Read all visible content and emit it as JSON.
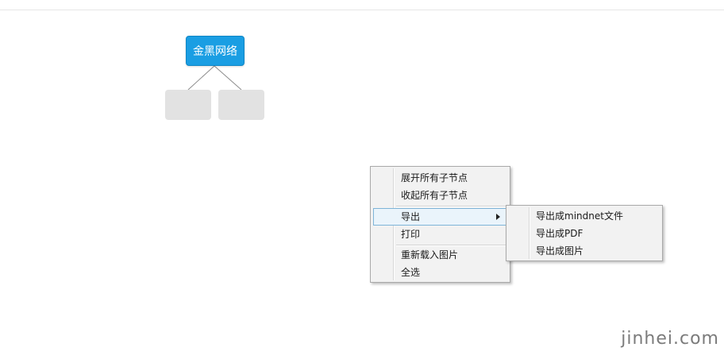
{
  "mindmap": {
    "root_label": "金黑网络",
    "colors": {
      "root_fill": "#1a9ee3",
      "child_fill": "#e2e2e2",
      "connector": "#8c8c8c"
    }
  },
  "context_menu": {
    "items": [
      {
        "label": "展开所有子节点"
      },
      {
        "label": "收起所有子节点"
      },
      {
        "label": "导出",
        "has_submenu": true,
        "highlighted": true
      },
      {
        "label": "打印"
      },
      {
        "label": "重新载入图片"
      },
      {
        "label": "全选"
      }
    ],
    "submenu": {
      "items": [
        {
          "label": "导出成mindnet文件"
        },
        {
          "label": "导出成PDF"
        },
        {
          "label": "导出成图片"
        }
      ]
    }
  },
  "watermark": "jinhei.com"
}
